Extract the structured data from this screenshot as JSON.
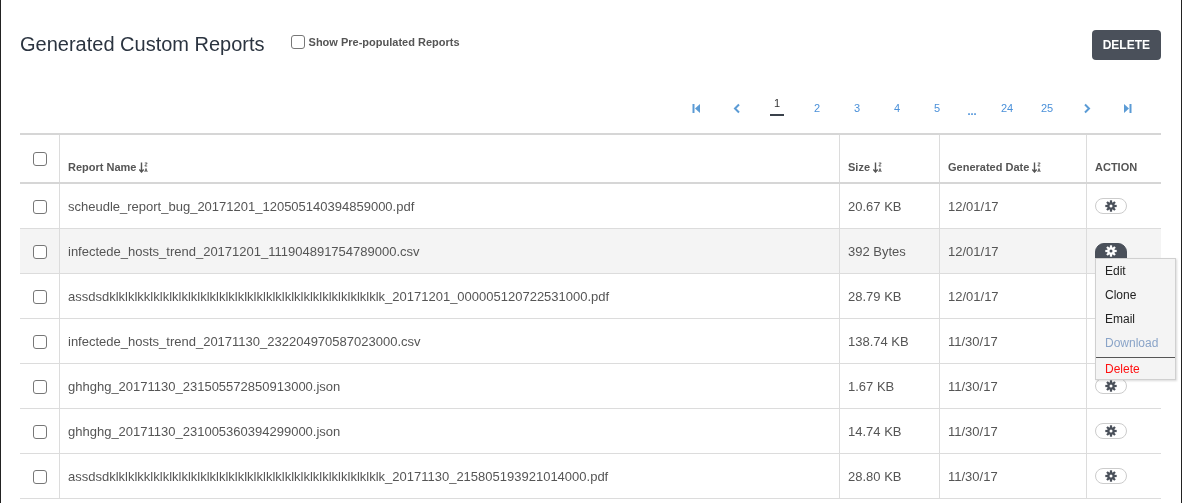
{
  "header": {
    "title": "Generated Custom Reports",
    "prepopulated": {
      "label": "Show Pre-populated Reports",
      "checked": false
    },
    "delete_button": "DELETE"
  },
  "pagination": {
    "pages": [
      {
        "kind": "first"
      },
      {
        "kind": "prev"
      },
      {
        "kind": "page",
        "label": "1",
        "selected": true
      },
      {
        "kind": "page",
        "label": "2",
        "selected": false
      },
      {
        "kind": "page",
        "label": "3",
        "selected": false
      },
      {
        "kind": "page",
        "label": "4",
        "selected": false
      },
      {
        "kind": "page",
        "label": "5",
        "selected": false
      },
      {
        "kind": "gap",
        "label": "..."
      },
      {
        "kind": "page",
        "label": "24",
        "selected": false
      },
      {
        "kind": "page",
        "label": "25",
        "selected": false
      },
      {
        "kind": "next"
      },
      {
        "kind": "last"
      }
    ]
  },
  "table": {
    "select_all": {
      "checked": false
    },
    "columns": [
      {
        "label": "Report Name",
        "sortable": true
      },
      {
        "label": "Size",
        "sortable": true
      },
      {
        "label": "Generated Date",
        "sortable": true
      },
      {
        "label": "ACTION",
        "sortable": false
      }
    ],
    "rows": [
      {
        "checked": false,
        "name": "scheudle_report_bug_20171201_120505140394859000.pdf",
        "size": "20.67 KB",
        "date": "12/01/17",
        "menu_open": false
      },
      {
        "checked": false,
        "name": "infectede_hosts_trend_20171201_111904891754789000.csv",
        "size": "392 Bytes",
        "date": "12/01/17",
        "menu_open": true
      },
      {
        "checked": false,
        "name": "assdsdklklklkklklklklklklklklklklklklklklklklklklklklklklklklklk_20171201_000005120722531000.pdf",
        "size": "28.79 KB",
        "date": "12/01/17"
      },
      {
        "checked": false,
        "name": "infectede_hosts_trend_20171130_232204970587023000.csv",
        "size": "138.74 KB",
        "date": "11/30/17"
      },
      {
        "checked": false,
        "name": "ghhghg_20171130_231505572850913000.json",
        "size": "1.67 KB",
        "date": "11/30/17",
        "menu_open": false
      },
      {
        "checked": false,
        "name": "ghhghg_20171130_231005360394299000.json",
        "size": "14.74 KB",
        "date": "11/30/17",
        "menu_open": false
      },
      {
        "checked": false,
        "name": "assdsdklklklkklklklklklklklklklklklklklklklklklklklklklklklklklk_20171130_215805193921014000.pdf",
        "size": "28.80 KB",
        "date": "11/30/17",
        "menu_open": false
      }
    ]
  },
  "action_menu": {
    "items": [
      {
        "label": "Edit",
        "kind": "normal",
        "hovered": false
      },
      {
        "label": "Clone",
        "kind": "normal",
        "hovered": false
      },
      {
        "label": "Email",
        "kind": "normal",
        "hovered": false
      },
      {
        "label": "Download",
        "kind": "normal",
        "hovered": true
      },
      {
        "label": "Delete",
        "kind": "danger",
        "hovered": false
      }
    ]
  }
}
